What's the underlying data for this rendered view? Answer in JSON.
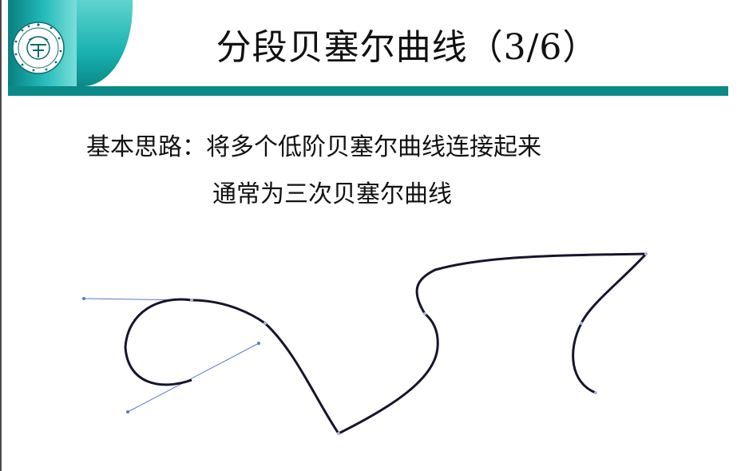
{
  "slide": {
    "title": "分段贝塞尔曲线（3/6）",
    "body_line_1": "基本思路：将多个低阶贝塞尔曲线连接起来",
    "body_line_2": "通常为三次贝塞尔曲线"
  },
  "logo": {
    "name": "university-seal",
    "ring_text": "CHINA UNIVERSITY OF GEOSCIENCES 中国地质大学"
  },
  "colors": {
    "header_teal": "#0a8a88",
    "curve": "#15152e",
    "control_handle": "#5b78c9"
  },
  "figure": {
    "curve_segments": 6,
    "control_handles": 2
  }
}
